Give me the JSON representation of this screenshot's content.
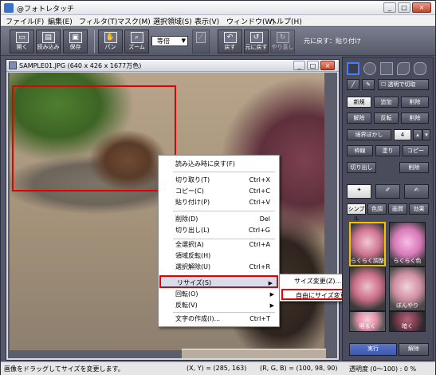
{
  "window": {
    "title": "@フォトレタッチ",
    "minimize": "_",
    "maximize": "□",
    "close": "×"
  },
  "menu": [
    "ファイル(F)",
    "編集(E)",
    "フィルタ(T)",
    "マスク(M)",
    "選択領域(S)",
    "表示(V)",
    "ウィンドウ(W)",
    "ヘルプ(H)"
  ],
  "toolbar": {
    "buttons": [
      {
        "name": "open-button",
        "label": "開く",
        "icon": "folder-icon"
      },
      {
        "name": "import-button",
        "label": "読み込み",
        "icon": "import-icon"
      },
      {
        "name": "save-button",
        "label": "保存",
        "icon": "save-icon"
      },
      {
        "name": "pan-button",
        "label": "パン",
        "icon": "hand-icon"
      },
      {
        "name": "zoom-button",
        "label": "ズーム",
        "icon": "magnifier-icon"
      },
      {
        "name": "undo-button",
        "label": "戻す",
        "icon": "undo-icon"
      },
      {
        "name": "revert-button",
        "label": "元に戻す",
        "icon": "revert-icon"
      },
      {
        "name": "redo-button",
        "label": "やり直し",
        "icon": "redo-icon"
      }
    ],
    "zoom": "等倍",
    "undo_status": "元に戻す：貼り付け"
  },
  "document": {
    "title": "SAMPLE01.JPG (640 x 426 x 1677万色)"
  },
  "context_menu": {
    "items": [
      {
        "label": "読み込み時に戻す(F)",
        "shortcut": ""
      },
      {
        "label": "切り取り(T)",
        "shortcut": "Ctrl+X"
      },
      {
        "label": "コピー(C)",
        "shortcut": "Ctrl+C"
      },
      {
        "label": "貼り付け(P)",
        "shortcut": "Ctrl+V"
      },
      {
        "label": "削除(D)",
        "shortcut": "Del"
      },
      {
        "label": "切り出し(L)",
        "shortcut": "Ctrl+G"
      },
      {
        "label": "全選択(A)",
        "shortcut": "Ctrl+A"
      },
      {
        "label": "領域反転(H)",
        "shortcut": ""
      },
      {
        "label": "選択解除(U)",
        "shortcut": "Ctrl+R"
      },
      {
        "label": "リサイズ(S)",
        "shortcut": "",
        "submenu": true
      },
      {
        "label": "回転(O)",
        "shortcut": "",
        "submenu": true
      },
      {
        "label": "反転(V)",
        "shortcut": "",
        "submenu": true
      },
      {
        "label": "文字の作成(I)...",
        "shortcut": "Ctrl+T"
      }
    ],
    "submenu": [
      "サイズ変更(Z)...",
      "自由にサイズ変更(F)"
    ]
  },
  "right_panel": {
    "transparent_cut": "透明で切取",
    "row1": [
      "新規",
      "追加",
      "削除"
    ],
    "row2": [
      "解除",
      "反転",
      "削除"
    ],
    "feather": {
      "label": "境界ぼかし",
      "value": "4"
    },
    "row3": [
      "枠線",
      "塗り",
      "コピー"
    ],
    "row4": [
      "切り出し",
      "削除"
    ],
    "tabs": [
      "シンプル",
      "色調",
      "画質",
      "効果"
    ],
    "presets": [
      "らくらく調整",
      "らくらく色",
      "",
      "ぼんやり",
      "明るく",
      "暗く"
    ],
    "apply": "実行",
    "cancel": "解除"
  },
  "statusbar": {
    "hint": "画像をドラッグしてサイズを変更します。",
    "coords": "(X, Y) = (285, 163)",
    "rgb": "(R, G, B) = (100, 98, 90)",
    "opacity": "透明度 (0〜100) : 0 %"
  }
}
